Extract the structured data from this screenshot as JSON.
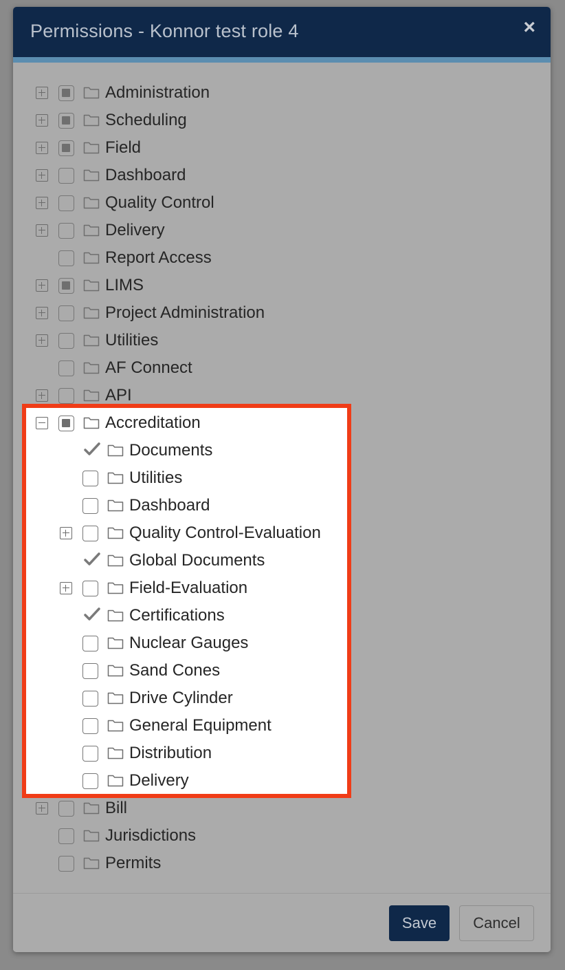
{
  "modal": {
    "title": "Permissions - Konnor test role 4",
    "close_label": "×",
    "save_label": "Save",
    "cancel_label": "Cancel",
    "colors": {
      "header": "#0f2849",
      "highlight_border": "#f03c17",
      "save_button": "#0f2849"
    }
  },
  "tree": [
    {
      "label": "Administration",
      "level": 0,
      "toggle": "plus",
      "check": "partial"
    },
    {
      "label": "Scheduling",
      "level": 0,
      "toggle": "plus",
      "check": "partial"
    },
    {
      "label": "Field",
      "level": 0,
      "toggle": "plus",
      "check": "partial"
    },
    {
      "label": "Dashboard",
      "level": 0,
      "toggle": "plus",
      "check": "unchecked"
    },
    {
      "label": "Quality Control",
      "level": 0,
      "toggle": "plus",
      "check": "unchecked"
    },
    {
      "label": "Delivery",
      "level": 0,
      "toggle": "plus",
      "check": "unchecked"
    },
    {
      "label": "Report Access",
      "level": 0,
      "toggle": "none",
      "check": "unchecked"
    },
    {
      "label": "LIMS",
      "level": 0,
      "toggle": "plus",
      "check": "partial"
    },
    {
      "label": "Project Administration",
      "level": 0,
      "toggle": "plus",
      "check": "unchecked"
    },
    {
      "label": "Utilities",
      "level": 0,
      "toggle": "plus",
      "check": "unchecked"
    },
    {
      "label": "AF Connect",
      "level": 0,
      "toggle": "none",
      "check": "unchecked"
    },
    {
      "label": "API",
      "level": 0,
      "toggle": "plus",
      "check": "unchecked"
    },
    {
      "label": "Accreditation",
      "level": 0,
      "toggle": "minus",
      "check": "partial"
    },
    {
      "label": "Documents",
      "level": 1,
      "toggle": "none",
      "check": "checked"
    },
    {
      "label": "Utilities",
      "level": 1,
      "toggle": "none",
      "check": "unchecked"
    },
    {
      "label": "Dashboard",
      "level": 1,
      "toggle": "none",
      "check": "unchecked"
    },
    {
      "label": "Quality Control-Evaluation",
      "level": 1,
      "toggle": "plus",
      "check": "unchecked"
    },
    {
      "label": "Global Documents",
      "level": 1,
      "toggle": "none",
      "check": "checked"
    },
    {
      "label": "Field-Evaluation",
      "level": 1,
      "toggle": "plus",
      "check": "unchecked"
    },
    {
      "label": "Certifications",
      "level": 1,
      "toggle": "none",
      "check": "checked"
    },
    {
      "label": "Nuclear Gauges",
      "level": 1,
      "toggle": "none",
      "check": "unchecked"
    },
    {
      "label": "Sand Cones",
      "level": 1,
      "toggle": "none",
      "check": "unchecked"
    },
    {
      "label": "Drive Cylinder",
      "level": 1,
      "toggle": "none",
      "check": "unchecked"
    },
    {
      "label": "General Equipment",
      "level": 1,
      "toggle": "none",
      "check": "unchecked"
    },
    {
      "label": "Distribution",
      "level": 1,
      "toggle": "none",
      "check": "unchecked"
    },
    {
      "label": "Delivery",
      "level": 1,
      "toggle": "none",
      "check": "unchecked"
    },
    {
      "label": "Bill",
      "level": 0,
      "toggle": "plus",
      "check": "unchecked"
    },
    {
      "label": "Jurisdictions",
      "level": 0,
      "toggle": "none",
      "check": "unchecked"
    },
    {
      "label": "Permits",
      "level": 0,
      "toggle": "none",
      "check": "unchecked"
    }
  ]
}
